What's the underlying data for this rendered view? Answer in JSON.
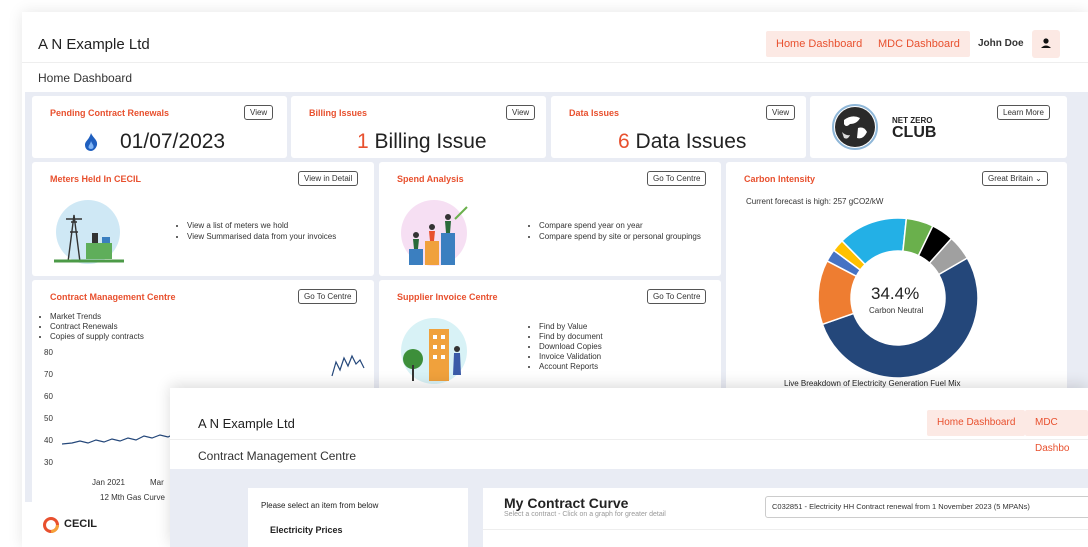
{
  "app": {
    "company": "A N Example Ltd",
    "nav": {
      "home": "Home Dashboard",
      "mdc": "MDC Dashboard"
    },
    "user_name": "John Doe",
    "breadcrumb": "Home Dashboard"
  },
  "cards": {
    "pending": {
      "title": "Pending Contract Renewals",
      "button": "View",
      "value": "01/07/2023"
    },
    "billing": {
      "title": "Billing Issues",
      "button": "View",
      "count": "1",
      "text": " Billing Issue"
    },
    "data_issues": {
      "title": "Data Issues",
      "button": "View",
      "count": "6",
      "text": " Data Issues"
    },
    "net_zero": {
      "line1": "NET ZERO",
      "line2": "CLUB",
      "button": "Learn More"
    },
    "meters": {
      "title": "Meters Held In CECIL",
      "button": "View in Detail",
      "bullets": [
        "View a list of meters we hold",
        "View Summarised data from your invoices"
      ]
    },
    "spend": {
      "title": "Spend Analysis",
      "button": "Go To Centre",
      "bullets": [
        "Compare spend year on year",
        "Compare spend by site or personal groupings"
      ]
    },
    "carbon": {
      "title": "Carbon Intensity",
      "region": "Great Britain",
      "forecast": "Current forecast is high: 257 gCO2/kW",
      "percent": "34.4%",
      "percent_label": "Carbon Neutral",
      "caption": "Live Breakdown of Electricity Generation Fuel Mix"
    },
    "contract_mgmt": {
      "title": "Contract Management Centre",
      "button": "Go To Centre",
      "bullets": [
        "Market Trends",
        "Contract Renewals",
        "Copies of supply contracts"
      ]
    },
    "supplier": {
      "title": "Supplier Invoice Centre",
      "button": "Go To Centre",
      "bullets": [
        "Find by Value",
        "Find by document",
        "Download Copies",
        "Invoice Validation",
        "Account Reports"
      ]
    }
  },
  "gas_chart_labels": {
    "y_ticks": [
      "80",
      "70",
      "60",
      "50",
      "40",
      "30"
    ],
    "x_ticks": [
      "Jan 2021",
      "Mar"
    ],
    "caption": "12 Mth Gas Curve"
  },
  "logo": "CECIL",
  "front_window": {
    "company": "A N Example Ltd",
    "nav": {
      "home": "Home Dashboard",
      "mdc": "MDC Dashbo"
    },
    "breadcrumb": "Contract Management Centre",
    "select_prompt": "Please select an item from below",
    "select_section": "Electricity Prices",
    "curve_title": "My Contract Curve",
    "curve_subtitle": "Select a contract - Click on a graph for greater detail",
    "contract_select": "C032851 - Electricity HH Contract renewal from 1 November 2023 (5 MPANs)"
  },
  "chart_data": {
    "type": "pie",
    "title": "Carbon Intensity",
    "categories": [
      "slice-1",
      "slice-2",
      "slice-3",
      "slice-4",
      "slice-5",
      "slice-6",
      "slice-7",
      "slice-8"
    ],
    "values": [
      53.0,
      13.0,
      2.5,
      2.5,
      14.0,
      5.5,
      4.5,
      5.0
    ],
    "colors": [
      "#24477a",
      "#ee7d31",
      "#4573c4",
      "#ffc100",
      "#23b0e6",
      "#6ab04c",
      "#000000",
      "#a0a0a0"
    ],
    "center_label": "34.4%",
    "center_sublabel": "Carbon Neutral"
  },
  "colors": {
    "accent": "#e8502e",
    "accent_bg": "#fce9e4",
    "dash_bg": "#e9ecf4"
  }
}
